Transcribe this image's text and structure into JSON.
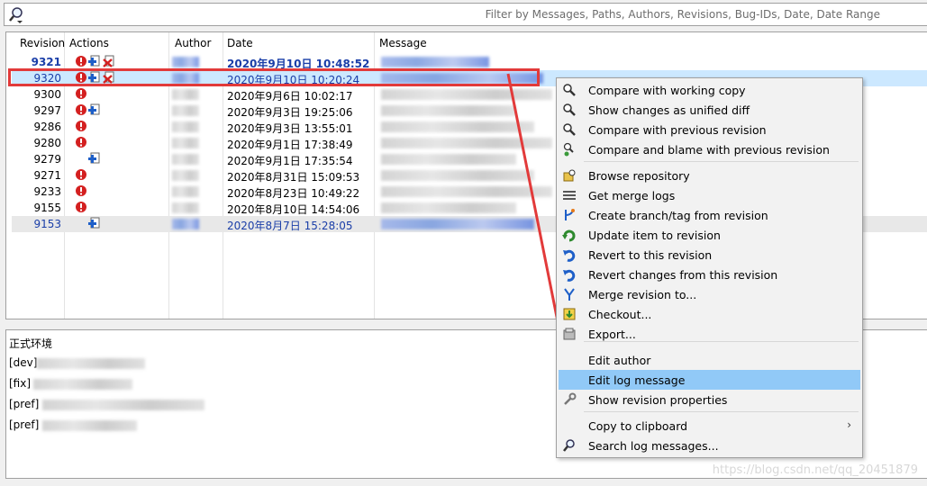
{
  "search": {
    "placeholder": "Filter by Messages, Paths, Authors, Revisions, Bug-IDs, Date, Date Range"
  },
  "table": {
    "headers": [
      "Revision",
      "Actions",
      "Author",
      "Date",
      "Message"
    ],
    "rows": [
      {
        "revision": "9321",
        "date": "2020年9月10日 10:48:52",
        "actions": [
          "modified",
          "added",
          "deleted"
        ]
      },
      {
        "revision": "9320",
        "date": "2020年9月10日 10:20:24",
        "actions": [
          "modified",
          "added",
          "deleted"
        ]
      },
      {
        "revision": "9300",
        "date": "2020年9月6日 10:02:17",
        "actions": [
          "modified"
        ]
      },
      {
        "revision": "9297",
        "date": "2020年9月3日 19:25:06",
        "actions": [
          "modified",
          "added"
        ]
      },
      {
        "revision": "9286",
        "date": "2020年9月3日 13:55:01",
        "actions": [
          "modified"
        ]
      },
      {
        "revision": "9280",
        "date": "2020年9月1日 17:38:49",
        "actions": [
          "modified"
        ]
      },
      {
        "revision": "9279",
        "date": "2020年9月1日 17:35:54",
        "actions": [
          "added"
        ]
      },
      {
        "revision": "9271",
        "date": "2020年8月31日 15:09:53",
        "actions": [
          "modified"
        ]
      },
      {
        "revision": "9233",
        "date": "2020年8月23日 10:49:22",
        "actions": [
          "modified"
        ]
      },
      {
        "revision": "9155",
        "date": "2020年8月10日 14:54:06",
        "actions": [
          "modified"
        ]
      },
      {
        "revision": "9153",
        "date": "2020年8月7日 15:28:05",
        "actions": [
          "added"
        ]
      }
    ]
  },
  "message_pane": {
    "lines": [
      "正式环境",
      "[dev]",
      "[fix]",
      "[pref]",
      "[pref]"
    ]
  },
  "context_menu": {
    "items": [
      {
        "label": "Compare with working copy",
        "icon": "compare-icon"
      },
      {
        "label": "Show changes as unified diff",
        "icon": "diff-icon"
      },
      {
        "label": "Compare with previous revision",
        "icon": "compare-prev-icon"
      },
      {
        "label": "Compare and blame with previous revision",
        "icon": "blame-icon"
      },
      {
        "label": "Browse repository",
        "icon": "repo-browser-icon"
      },
      {
        "label": "Get merge logs",
        "icon": "merge-logs-icon"
      },
      {
        "label": "Create branch/tag from revision",
        "icon": "branch-icon"
      },
      {
        "label": "Update item to revision",
        "icon": "update-icon"
      },
      {
        "label": "Revert to this revision",
        "icon": "revert-icon"
      },
      {
        "label": "Revert changes from this revision",
        "icon": "revert-changes-icon"
      },
      {
        "label": "Merge revision to...",
        "icon": "merge-icon"
      },
      {
        "label": "Checkout...",
        "icon": "checkout-icon"
      },
      {
        "label": "Export...",
        "icon": "export-icon"
      },
      {
        "label": "Edit author",
        "icon": ""
      },
      {
        "label": "Edit log message",
        "icon": ""
      },
      {
        "label": "Show revision properties",
        "icon": "wrench-icon"
      },
      {
        "label": "Copy to clipboard",
        "icon": ""
      },
      {
        "label": "Search log messages...",
        "icon": "search-icon"
      }
    ],
    "highlighted": "Edit log message"
  },
  "watermark": "https://blog.csdn.net/qq_20451879",
  "colors": {
    "selected_row": "#cce8ff",
    "highlighted_menu_item": "#91c9f7",
    "annotation_red": "#e23a3a",
    "revision_blue": "#1a3ea8"
  }
}
